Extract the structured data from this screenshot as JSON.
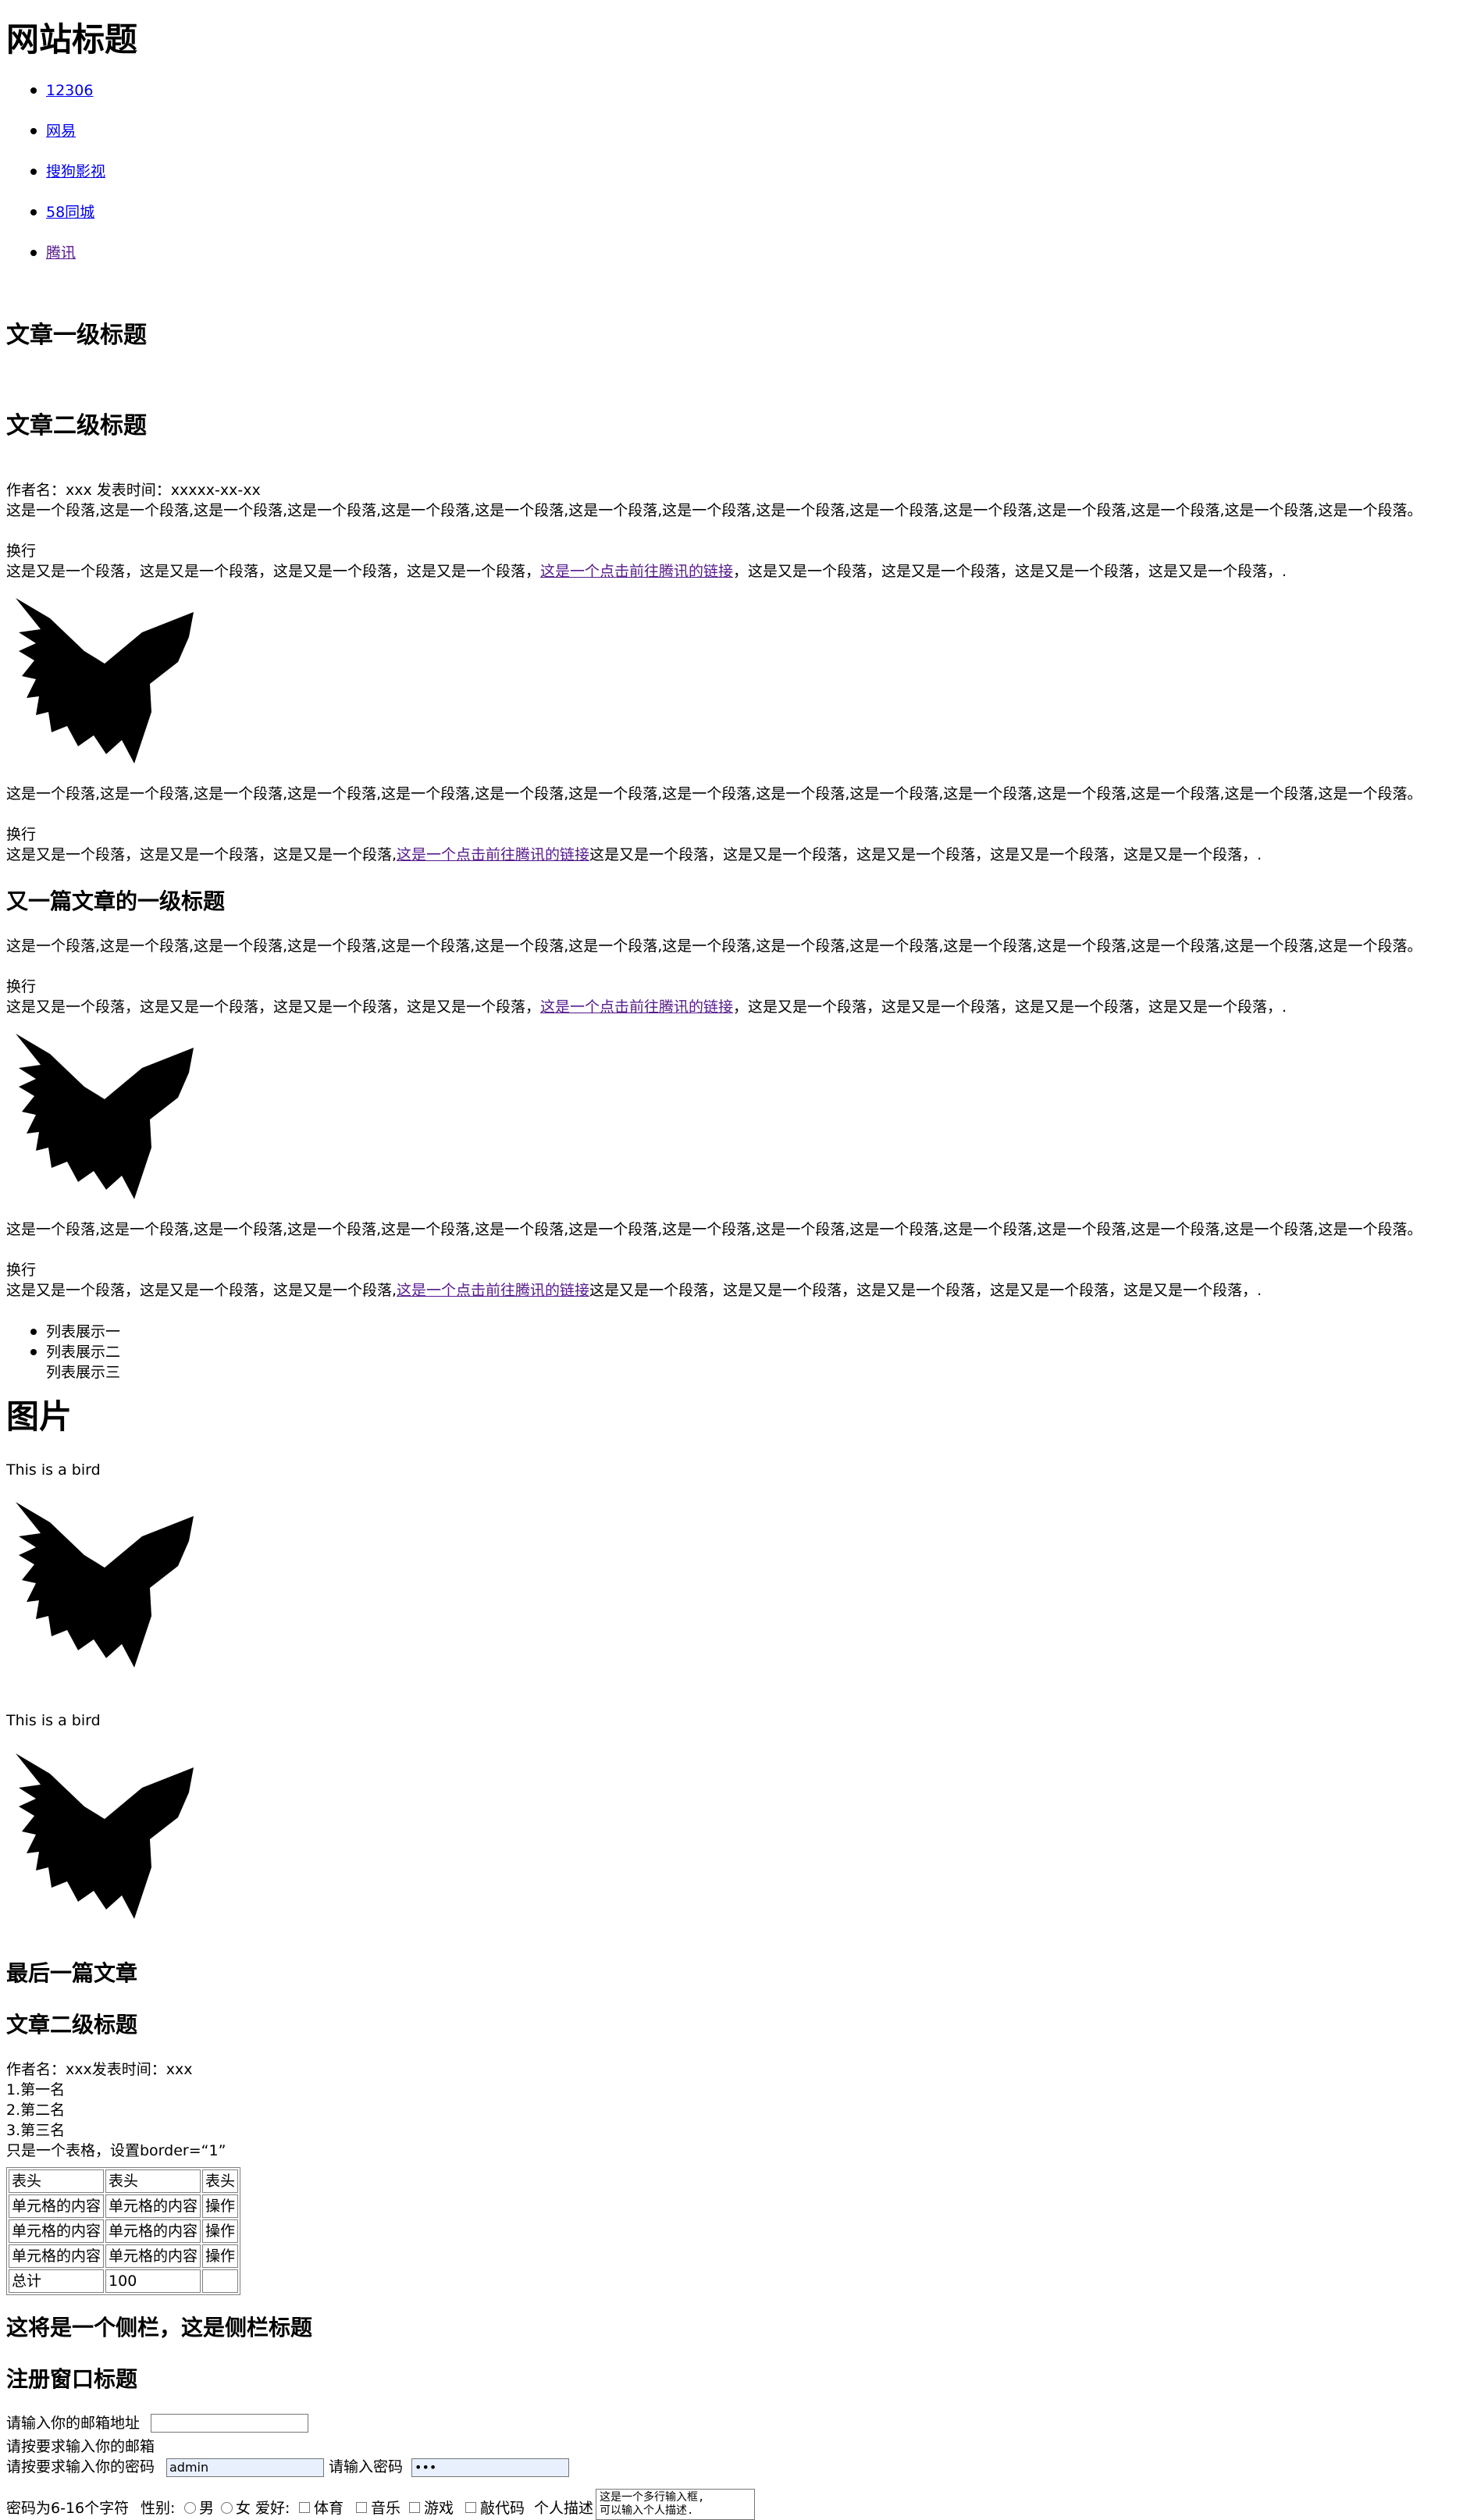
{
  "site_title": "网站标题",
  "nav_links": [
    "12306",
    "网易",
    "搜狗影视",
    "58同城",
    "腾讯"
  ],
  "article1": {
    "h1": "文章一级标题",
    "h2": "文章二级标题",
    "meta": "作者名：xxx 发表时间：xxxxx-xx-xx",
    "p1": "这是一个段落,这是一个段落,这是一个段落,这是一个段落,这是一个段落,这是一个段落,这是一个段落,这是一个段落,这是一个段落,这是一个段落,这是一个段落,这是一个段落,这是一个段落,这是一个段落,这是一个段落。",
    "br": "换行",
    "p2_before": "这是又是一个段落，这是又是一个段落，这是又是一个段落，这是又是一个段落，",
    "p2_link": "这是一个点击前往腾讯的链接",
    "p2_after": "，这是又是一个段落，这是又是一个段落，这是又是一个段落，这是又是一个段落，.",
    "p3": "这是一个段落,这是一个段落,这是一个段落,这是一个段落,这是一个段落,这是一个段落,这是一个段落,这是一个段落,这是一个段落,这是一个段落,这是一个段落,这是一个段落,这是一个段落,这是一个段落,这是一个段落。",
    "br2": "换行",
    "p4_before": "这是又是一个段落，这是又是一个段落，这是又是一个段落,",
    "p4_link": "这是一个点击前往腾讯的链接",
    "p4_after": "这是又是一个段落，这是又是一个段落，这是又是一个段落，这是又是一个段落，这是又是一个段落，."
  },
  "article2": {
    "h3": "又一篇文章的一级标题",
    "p1": "这是一个段落,这是一个段落,这是一个段落,这是一个段落,这是一个段落,这是一个段落,这是一个段落,这是一个段落,这是一个段落,这是一个段落,这是一个段落,这是一个段落,这是一个段落,这是一个段落,这是一个段落。",
    "br": "换行",
    "p2_before": "这是又是一个段落，这是又是一个段落，这是又是一个段落，这是又是一个段落，",
    "p2_link": "这是一个点击前往腾讯的链接",
    "p2_after": "，这是又是一个段落，这是又是一个段落，这是又是一个段落，这是又是一个段落，.",
    "p3": "这是一个段落,这是一个段落,这是一个段落,这是一个段落,这是一个段落,这是一个段落,这是一个段落,这是一个段落,这是一个段落,这是一个段落,这是一个段落,这是一个段落,这是一个段落,这是一个段落,这是一个段落。",
    "br2": "换行",
    "p4_before": "这是又是一个段落，这是又是一个段落，这是又是一个段落,",
    "p4_link": "这是一个点击前往腾讯的链接",
    "p4_after": "这是又是一个段落，这是又是一个段落，这是又是一个段落，这是又是一个段落，这是又是一个段落，.",
    "list": [
      "列表展示一",
      "列表展示二",
      "列表展示三"
    ]
  },
  "pictures": {
    "heading": "图片",
    "caption1": "This is a bird",
    "caption2": "This is a bird"
  },
  "last_article": {
    "h3": "最后一篇文章",
    "h3b": "文章二级标题",
    "meta": "作者名：xxx发表时间：xxx",
    "ranks": [
      "1.第一名",
      "2.第二名",
      "3.第三名"
    ],
    "table_note": "只是一个表格，设置border=“1”",
    "table": {
      "header": [
        "表头",
        "表头",
        "表头"
      ],
      "rows": [
        [
          "单元格的内容",
          "单元格的内容",
          "操作"
        ],
        [
          "单元格的内容",
          "单元格的内容",
          "操作"
        ],
        [
          "单元格的内容",
          "单元格的内容",
          "操作"
        ]
      ],
      "footer": [
        "总计",
        "100",
        ""
      ]
    }
  },
  "sidebar_title": "这将是一个侧栏，这是侧栏标题",
  "register": {
    "title": "注册窗口标题",
    "email_label": "请输入你的邮箱地址",
    "email_value": "",
    "email_hint": "请按要求输入你的邮箱",
    "user_label": "请按要求输入你的密码",
    "user_value": "admin",
    "pwd_label": "请输入密码",
    "pwd_value": "•••",
    "pwd_hint": "密码为6-16个字符",
    "gender_label": "性别:",
    "gender_options": [
      "男",
      "女"
    ],
    "hobby_label": "爱好:",
    "hobbies": [
      "体育",
      "音乐",
      "游戏",
      "敲代码"
    ],
    "desc_label": "个人描述",
    "textarea_value": "这是一个多行输入框,\n可以输入个人描述."
  }
}
